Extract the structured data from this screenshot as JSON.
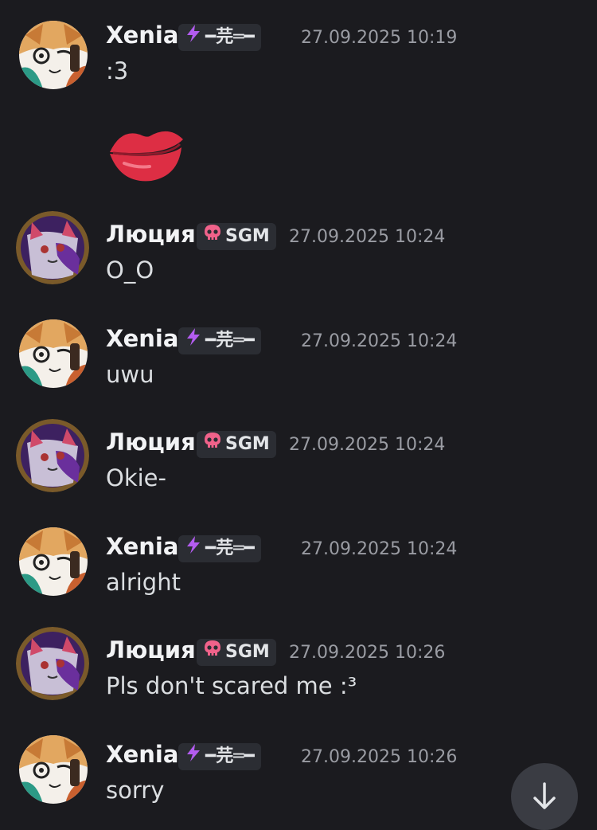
{
  "messages": [
    {
      "author": "Xenia",
      "tag_text": "━芫═━",
      "tag_icon": "lightning-icon",
      "time": "27.09.2025 10:19",
      "text": ":3",
      "attachment": "kiss-emoji"
    },
    {
      "author": "Люция",
      "tag_text": "SGM",
      "tag_icon": "skull-icon",
      "time": "27.09.2025 10:24",
      "text": "O_O"
    },
    {
      "author": "Xenia",
      "tag_text": "━芫═━",
      "tag_icon": "lightning-icon",
      "time": "27.09.2025 10:24",
      "text": "uwu"
    },
    {
      "author": "Люция",
      "tag_text": "SGM",
      "tag_icon": "skull-icon",
      "time": "27.09.2025 10:24",
      "text": "Okie-"
    },
    {
      "author": "Xenia",
      "tag_text": "━芫═━",
      "tag_icon": "lightning-icon",
      "time": "27.09.2025 10:24",
      "text": "alright"
    },
    {
      "author": "Люция",
      "tag_text": "SGM",
      "tag_icon": "skull-icon",
      "time": "27.09.2025 10:26",
      "text": "Pls don't scared me :³"
    },
    {
      "author": "Xenia",
      "tag_text": "━芫═━",
      "tag_icon": "lightning-icon",
      "time": "27.09.2025 10:26",
      "text": "sorry"
    }
  ],
  "colors": {
    "background": "#1b1b1f",
    "tag_background": "#2b2d33",
    "timestamp": "#9a9ca3",
    "lightning": "#b35cf0",
    "skull": "#f0628a",
    "kiss": "#dd2e44"
  },
  "scroll_button": {
    "icon": "arrow-down-icon"
  }
}
